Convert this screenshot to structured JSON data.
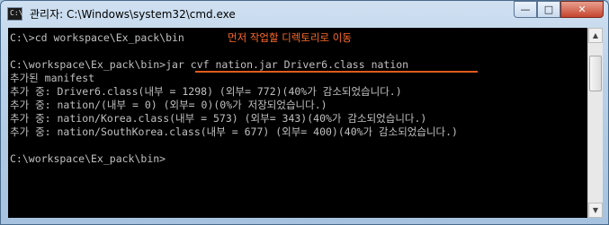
{
  "window": {
    "icon_text": "C:\\",
    "title": "관리자: C:\\Windows\\system32\\cmd.exe",
    "minimize_glyph": "—",
    "maximize_glyph": "□",
    "close_glyph": "✕"
  },
  "console": {
    "lines": [
      "C:\\>cd workspace\\Ex_pack\\bin",
      "",
      "C:\\workspace\\Ex_pack\\bin>jar cvf nation.jar Driver6.class nation",
      "추가된 manifest",
      "추가 중: Driver6.class(내부 = 1298) (외부= 772)(40%가 감소되었습니다.)",
      "추가 중: nation/(내부 = 0) (외부= 0)(0%가 저장되었습니다.)",
      "추가 중: nation/Korea.class(내부 = 573) (외부= 343)(40%가 감소되었습니다.)",
      "추가 중: nation/SouthKorea.class(내부 = 677) (외부= 400)(40%가 감소되었습니다.)",
      "",
      "C:\\workspace\\Ex_pack\\bin>"
    ],
    "annotation": "먼저 작업할 디렉토리로 이동",
    "highlight_color": "#e05a1e"
  },
  "scrollbar": {
    "up_glyph": "▲",
    "down_glyph": "▼"
  }
}
